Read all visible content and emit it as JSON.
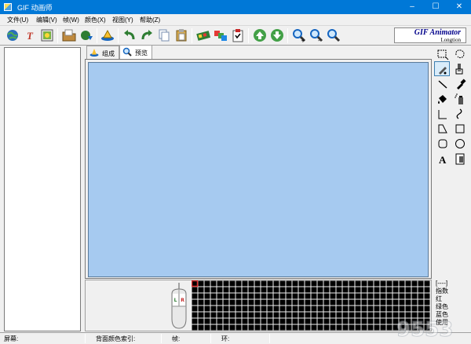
{
  "window": {
    "title": "GIF 动画师",
    "minimize": "–",
    "maximize": "☐",
    "close": "✕"
  },
  "menu": {
    "items": [
      "文件(U)",
      "编辑(V)",
      "帧(W)",
      "颜色(X)",
      "视图(Y)",
      "帮助(Z)"
    ]
  },
  "brand": {
    "line1": "GIF Animator",
    "line2": "Longtion"
  },
  "tabs": {
    "compose": "组成",
    "preview": "预览"
  },
  "mouse": {
    "left": "L",
    "right": "R"
  },
  "color_info": {
    "items": [
      "[----]",
      "指数",
      "红",
      "绿色",
      "蓝色",
      "使用"
    ]
  },
  "status": {
    "screen": "屏幕:",
    "bg_index": "背面颜色索引:",
    "frame": "帧:",
    "loop": "环:"
  },
  "palette": {
    "rows": 8,
    "cols": 38,
    "cell_color": "#000000",
    "selected_border": "#e03030"
  },
  "colors": {
    "titlebar": "#0078d7",
    "canvas_bg": "#a6caf0",
    "brand_text": "#00008b"
  }
}
